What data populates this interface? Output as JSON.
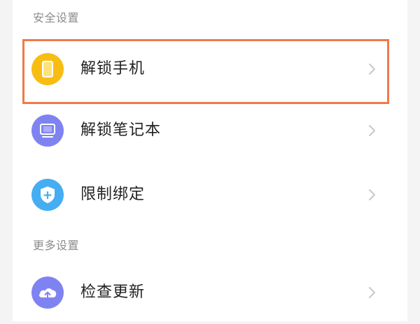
{
  "sections": {
    "security": {
      "title": "安全设置"
    },
    "more": {
      "title": "更多设置"
    }
  },
  "items": [
    {
      "label": "解锁手机",
      "icon": "phone-icon",
      "color": "#f8bd13",
      "highlighted": true
    },
    {
      "label": "解锁笔记本",
      "icon": "laptop-icon",
      "color": "#7f83f2",
      "highlighted": false
    },
    {
      "label": "限制绑定",
      "icon": "shield-plus-icon",
      "color": "#45aef2",
      "highlighted": false
    },
    {
      "label": "检查更新",
      "icon": "cloud-upload-icon",
      "color": "#7f83f2",
      "highlighted": false
    }
  ],
  "colors": {
    "highlight_border": "#ef7a4c",
    "section_text": "#8c8c8c",
    "chevron": "#c8c8c8"
  }
}
